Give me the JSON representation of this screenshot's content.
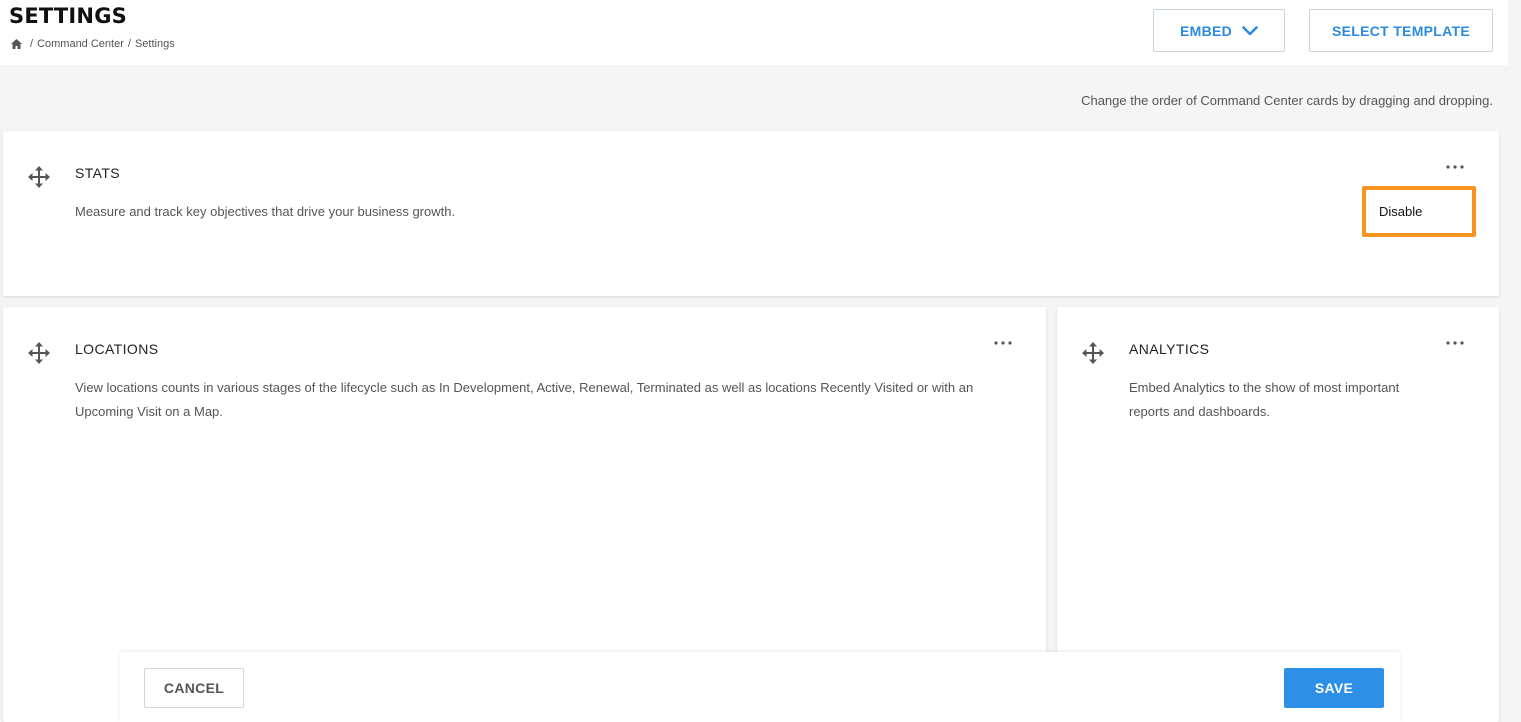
{
  "header": {
    "title": "SETTINGS",
    "breadcrumb": {
      "home_icon": "home-icon",
      "items": [
        "Command Center",
        "Settings"
      ],
      "separator": "/"
    },
    "embed_label": "EMBED",
    "select_template_label": "SELECT TEMPLATE"
  },
  "hint": "Change the order of Command Center cards by dragging and dropping.",
  "cards": {
    "stats": {
      "title": "STATS",
      "description": "Measure and track key objectives that drive your business growth."
    },
    "locations": {
      "title": "LOCATIONS",
      "description": "View locations counts in various stages of the lifecycle such as In Development, Active, Renewal, Terminated as well as locations Recently Visited or with an Upcoming Visit on a Map."
    },
    "analytics": {
      "title": "ANALYTICS",
      "description": "Embed Analytics to the show of most important reports and dashboards."
    }
  },
  "menu": {
    "disable_label": "Disable",
    "highlight_color": "#f7931e"
  },
  "footer": {
    "cancel_label": "CANCEL",
    "save_label": "SAVE"
  },
  "colors": {
    "accent": "#2a8be0",
    "save_bg": "#2e8fe6"
  }
}
